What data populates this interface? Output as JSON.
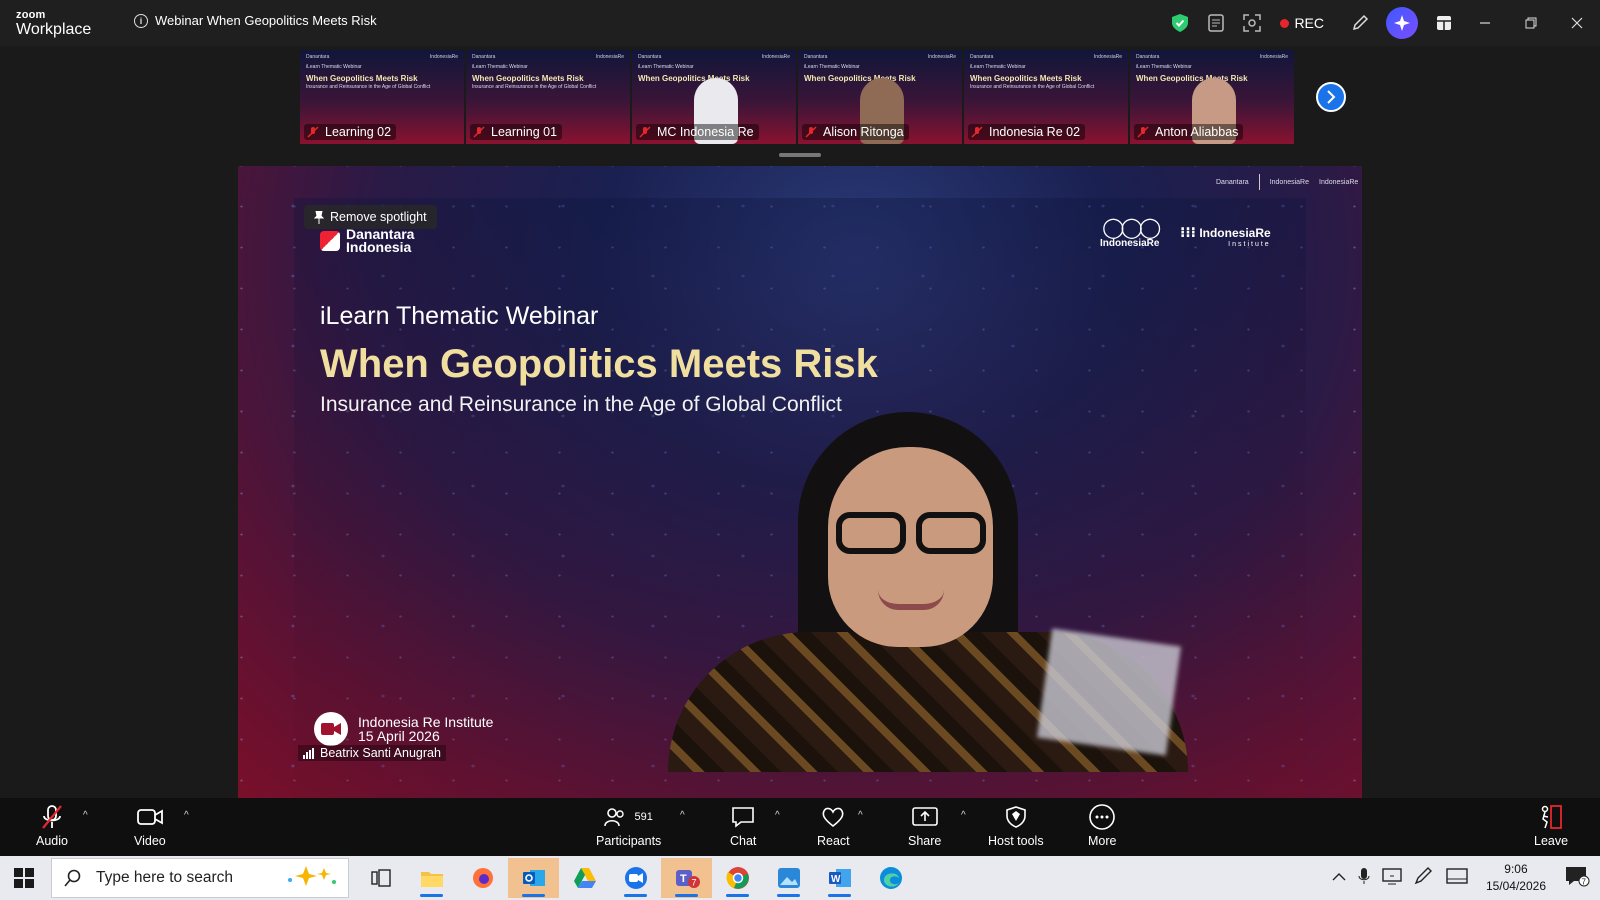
{
  "app": {
    "brand_line1": "zoom",
    "brand_line2": "Workplace"
  },
  "meeting": {
    "title": "Webinar When Geopolitics Meets Risk",
    "rec_label": "REC"
  },
  "thumbnails": [
    {
      "name": "Learning 02",
      "kind": "slide"
    },
    {
      "name": "Learning 01",
      "kind": "slide"
    },
    {
      "name": "MC Indonesia Re",
      "kind": "person-hijab"
    },
    {
      "name": "Alison Ritonga",
      "kind": "person"
    },
    {
      "name": "Indonesia Re 02",
      "kind": "slide"
    },
    {
      "name": "Anton Aliabbas",
      "kind": "person"
    }
  ],
  "thumb_slide": {
    "kicker": "iLearn Thematic Webinar",
    "title": "When Geopolitics Meets Risk",
    "sub": "Insurance and Reinsurance in the Age of Global Conflict"
  },
  "spotlight": {
    "label": "Remove spotlight"
  },
  "slide": {
    "logo_left_line1": "Danantara",
    "logo_left_line2": "Indonesia",
    "logo_ir": "IndonesiaRe",
    "logo_iri": "IndonesiaRe",
    "logo_iri_sub": "Institute",
    "kicker": "iLearn Thematic Webinar",
    "title": "When Geopolitics Meets Risk",
    "subtitle": "Insurance and Reinsurance in the Age of Global Conflict",
    "footer_org": "Indonesia Re Institute",
    "footer_date": "15 April 2026"
  },
  "speaker": {
    "name": "Beatrix Santi Anugrah"
  },
  "toolbar": {
    "audio": "Audio",
    "video": "Video",
    "participants": "Participants",
    "participants_count": "591",
    "chat": "Chat",
    "react": "React",
    "share": "Share",
    "host_tools": "Host tools",
    "more": "More",
    "leave": "Leave"
  },
  "taskbar": {
    "search_placeholder": "Type here to search",
    "time": "9:06",
    "date": "15/04/2026",
    "notification_count": "7"
  },
  "colors": {
    "accent": "#1a73e8",
    "rec": "#e5262c",
    "title_gold": "#f1dfa0"
  }
}
